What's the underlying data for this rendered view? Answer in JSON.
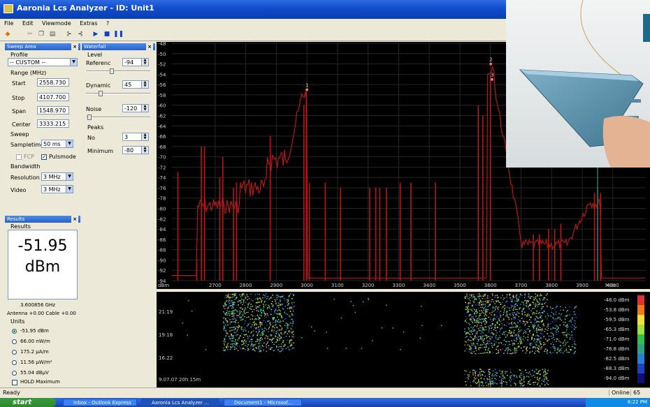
{
  "window": {
    "title": "Aaronia Lcs Analyzer - ID: Unit1"
  },
  "menu": [
    "File",
    "Edit",
    "Viewmode",
    "Extras",
    "?"
  ],
  "toolbar": {
    "icons": [
      "diamond-icon",
      "cut-icon",
      "copy-icon",
      "paste-icon",
      "settings-icon",
      "settings2-icon",
      "play-icon",
      "stop-icon",
      "pause-icon"
    ]
  },
  "sweep": {
    "panel_title": "Sweep Area",
    "profile_label": "Profile",
    "profile_value": "-- CUSTOM --",
    "range_label": "Range (MHz)",
    "start_label": "Start",
    "start_value": "2558.730",
    "stop_label": "Stop",
    "stop_value": "4107.700",
    "span_label": "Span",
    "span_value": "1548.970",
    "center_label": "Center",
    "center_value": "3333.215",
    "sweep_label": "Sweep",
    "sampletime_label": "Sampletime",
    "sampletime_value": "50 ms",
    "fcp_label": "FCP",
    "pulsmode_label": "Pulsmode",
    "bandwidth_label": "Bandwidth",
    "resolution_label": "Resolution",
    "resolution_value": "3 MHz",
    "video_label": "Video",
    "video_value": "3 MHz"
  },
  "waterfall_panel": {
    "panel_title": "Waterfall",
    "level_label": "Level",
    "reference_label": "Referenc",
    "reference_value": "-94",
    "dynamic_label": "Dynamic",
    "dynamic_value": "45",
    "noise_label": "Noise",
    "noise_value": "-120",
    "peaks_label": "Peaks",
    "no_label": "No",
    "no_value": "3",
    "minimum_label": "Minimum",
    "minimum_value": "-80"
  },
  "results": {
    "panel_title": "Results",
    "group_label": "Results",
    "value": "-51.95",
    "unit": "dBm",
    "frequency": "3.600856 GHz",
    "antenna": "Antenna +0.00 Cable +0.00",
    "units_label": "Units",
    "units": [
      "-51.95 dBm",
      "66.00 nW/m",
      "175.2 µA/m",
      "11.56 µW/m²",
      "55.04 dBµV"
    ],
    "hold_label": "HOLD Maximum"
  },
  "spectrum": {
    "y_ticks": [
      "-48",
      "-50",
      "-52",
      "-54",
      "-56",
      "-58",
      "-60",
      "-62",
      "-64",
      "-66",
      "-68",
      "-70",
      "-72",
      "-74",
      "-76",
      "-78",
      "-80",
      "-82",
      "-84",
      "-86",
      "-88",
      "-90",
      "-92",
      "-94"
    ],
    "x_ticks": [
      "2700",
      "2800",
      "2900",
      "3000",
      "3100",
      "3200",
      "3300",
      "3400",
      "3500",
      "3600",
      "3700",
      "3800",
      "3900",
      "4000"
    ],
    "y_unit": "dBm",
    "x_unit": "MHz",
    "markers": [
      "1",
      "2",
      "3"
    ]
  },
  "waterfall": {
    "time_labels": [
      "21:19",
      "19:18",
      "16:22"
    ],
    "timestamp": "9.07.07 20h 15m",
    "scale": [
      "-48.0 dBm",
      "-53.8 dBm",
      "-59.5 dBm",
      "-65.3 dBm",
      "-71.0 dBm",
      "-76.8 dBm",
      "-82.5 dBm",
      "-88.3 dBm",
      "-94.0 dBm"
    ]
  },
  "status": {
    "left": "Ready",
    "online": "Online",
    "count": "65"
  },
  "taskbar": {
    "start": "start",
    "tasks": [
      "Inbox - Outlook Express",
      "Aaronia Lcs Analyzer ...",
      "Document1 - Microsof..."
    ],
    "clock": "8:22 PM"
  },
  "colors": {
    "trace": "#b51818",
    "grid": "#2a2a2a",
    "title_bar": "#0f4bcc"
  }
}
